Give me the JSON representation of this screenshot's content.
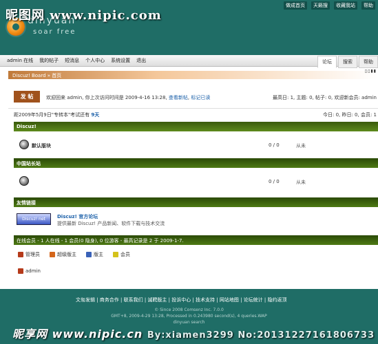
{
  "top_links": [
    "做成首页",
    "天籁搜",
    "收藏我站",
    "帮助"
  ],
  "watermark_top": "昵图网 www.nipic.com",
  "logo": {
    "name": "dinyuan",
    "slogan": "soar free"
  },
  "menu": {
    "user": "admin 在线",
    "items": [
      "我的帖子",
      "短消息",
      "个人中心",
      "系统设置",
      "退出"
    ],
    "tabs": [
      "论坛",
      "搜索",
      "帮助"
    ],
    "active_tab": "论坛"
  },
  "breadcrumb": "Discuz! Board » 首页",
  "view_switch": "▯▯▮▮",
  "post_button": "发 帖",
  "welcome": {
    "text": "欢迎回来 admin, 你上次访问时间是 2009-4-16 13:28,",
    "link1": "查看新帖",
    "link2": "标记已读"
  },
  "stats": "最高日: 1, 主题: 0, 帖子: 0, 欢迎新会员: admin",
  "countdown": {
    "text": "距2009年5月9日\"专转本\"考试还有",
    "days": "9天"
  },
  "today": "今日: 0, 昨日: 0, 会员: 1",
  "sections": [
    {
      "title": "Discuz!",
      "forum": "默认版块",
      "counts": "0 / 0",
      "last": "从未"
    },
    {
      "title": "中国站长站",
      "forum": "",
      "counts": "0 / 0",
      "last": "从未"
    }
  ],
  "links_section": {
    "title": "友情链接",
    "logo_text": "Discuz! net",
    "name": "Discuz! 官方论坛",
    "desc": "提供最新 Discuz! 产品新闻、软件下载与技术交流"
  },
  "online": "在线会员 - 1 人在线 - 1 会员(0 隐身), 0 位游客 - 最高记录是 2 于 2009-1-7.",
  "legend": [
    {
      "label": "管理员",
      "color": "#b53a1a"
    },
    {
      "label": "超级版主",
      "color": "#d4661b"
    },
    {
      "label": "版主",
      "color": "#3a62b8"
    },
    {
      "label": "会员",
      "color": "#d4c21b"
    }
  ],
  "online_user": "admin",
  "footer": {
    "links": "文匆发辑 | 商务合作 | 联系我们 | 诚聘版主 | 投诉中心 | 技术支持 | 网站地图 | 论坛统计 | 隐约返顶",
    "copyright": "© Since 2008 Comsenz Inc. 7.0.0",
    "processed": "GMT+8, 2009-4-29 13:28, Processed in 0.243980 second(s), 4 queries.WAP",
    "small": "dinyuan search"
  },
  "watermark_bottom": {
    "main": "昵享网 www.nipic.cn",
    "by": "By:xiamen3299 No:20131227161806733"
  }
}
